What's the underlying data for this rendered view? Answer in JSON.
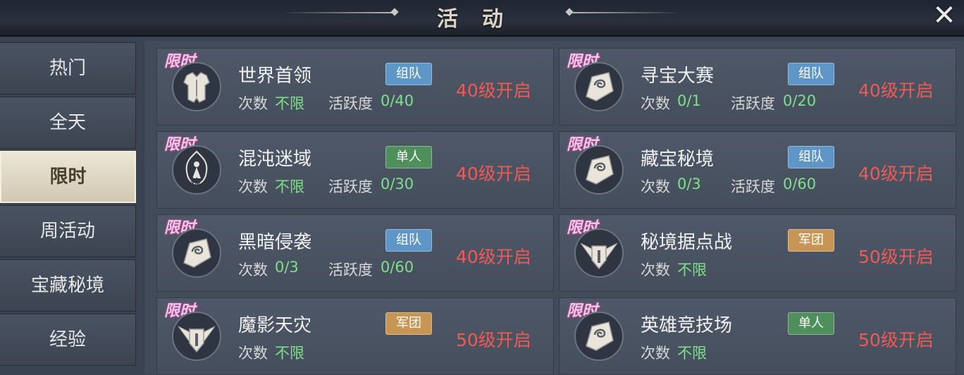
{
  "header": {
    "title": "活动",
    "close_icon": "close-icon"
  },
  "sidebar": {
    "tabs": [
      {
        "label": "热门",
        "active": false
      },
      {
        "label": "全天",
        "active": false
      },
      {
        "label": "限时",
        "active": true
      },
      {
        "label": "周活动",
        "active": false
      },
      {
        "label": "宝藏秘境",
        "active": false
      },
      {
        "label": "经验",
        "active": false
      }
    ]
  },
  "colors": {
    "team_badge": "#5d96c7",
    "solo_badge": "#4f8f5c",
    "army_badge": "#c79654",
    "count_value": "#7ee08a",
    "open_level": "#ef5a55",
    "limited_tag": "#f2c6e6"
  },
  "labels": {
    "count": "次数",
    "activity": "活跃度",
    "limited": "限时"
  },
  "cards": [
    {
      "name": "世界首领",
      "badge": "组队",
      "badge_type": "team",
      "count": "不限",
      "activity": "0/40",
      "open": "40级开启",
      "icon": "armor-icon"
    },
    {
      "name": "寻宝大赛",
      "badge": "组队",
      "badge_type": "team",
      "count": "0/1",
      "activity": "0/20",
      "open": "40级开启",
      "icon": "rune-stone-icon"
    },
    {
      "name": "混沌迷域",
      "badge": "单人",
      "badge_type": "solo",
      "count": "不限",
      "activity": "0/30",
      "open": "40级开启",
      "icon": "flame-figure-icon",
      "icon_text": "炼"
    },
    {
      "name": "藏宝秘境",
      "badge": "组队",
      "badge_type": "team",
      "count": "0/3",
      "activity": "0/60",
      "open": "40级开启",
      "icon": "rune-stone-icon"
    },
    {
      "name": "黑暗侵袭",
      "badge": "组队",
      "badge_type": "team",
      "count": "0/3",
      "activity": "0/60",
      "open": "40级开启",
      "icon": "rune-stone-icon"
    },
    {
      "name": "秘境据点战",
      "badge": "军团",
      "badge_type": "army",
      "count": "不限",
      "activity": null,
      "open": "50级开启",
      "icon": "winged-shield-icon"
    },
    {
      "name": "魔影天灾",
      "badge": "军团",
      "badge_type": "army",
      "count": "不限",
      "activity": null,
      "open": "50级开启",
      "icon": "winged-shield-icon"
    },
    {
      "name": "英雄竞技场",
      "badge": "单人",
      "badge_type": "solo",
      "count": "不限",
      "activity": null,
      "open": "50级开启",
      "icon": "rune-stone-icon"
    }
  ]
}
